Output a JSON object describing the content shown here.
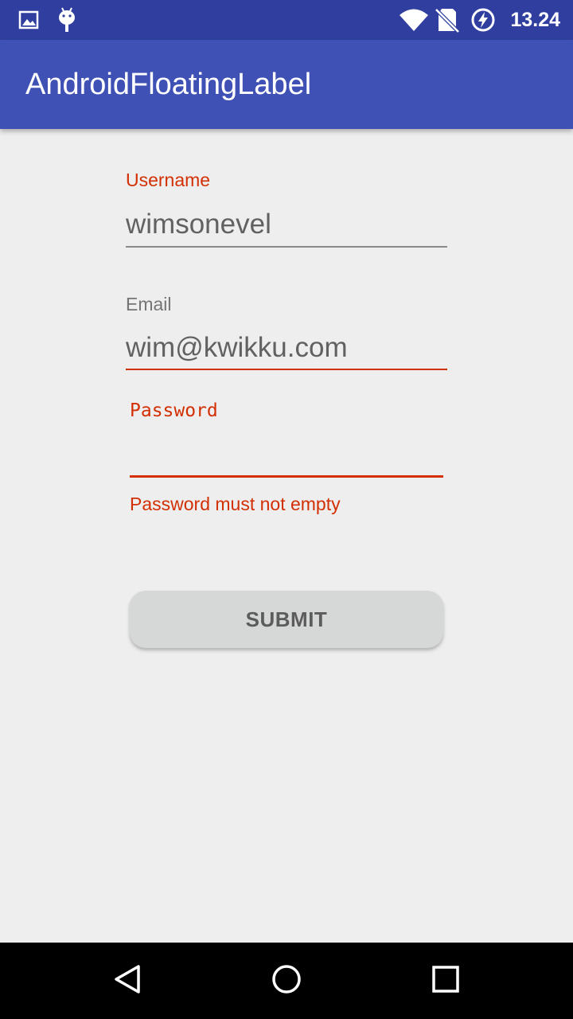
{
  "status_bar": {
    "time": "13.24",
    "icons": [
      "image-icon",
      "android-icon",
      "wifi-icon",
      "no-sim-icon",
      "battery-charging-icon"
    ]
  },
  "app_bar": {
    "title": "AndroidFloatingLabel",
    "color": "#3f51b5"
  },
  "form": {
    "username": {
      "label": "Username",
      "value": "wimsonevel"
    },
    "email": {
      "label": "Email",
      "value": "wim@kwikku.com"
    },
    "password": {
      "label": "Password",
      "value": "",
      "error": "Password must not empty"
    },
    "submit_label": "SUBMIT"
  },
  "nav_bar": {
    "icons": [
      "back-icon",
      "home-icon",
      "recents-icon"
    ]
  },
  "colors": {
    "status_bar": "#303f9f",
    "error": "#d32f04",
    "background": "#eeeeee"
  }
}
